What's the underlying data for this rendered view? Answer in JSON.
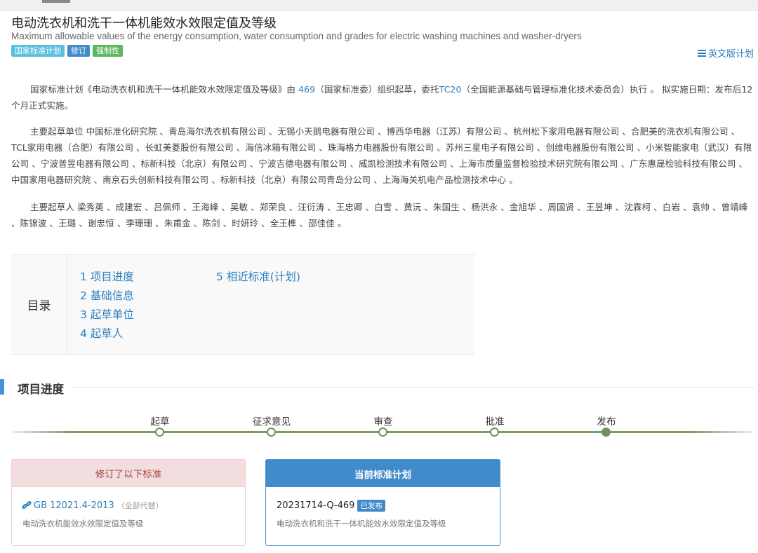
{
  "header": {
    "title": "电动洗衣机和洗干一体机能效水效限定值及等级",
    "subtitle": "Maximum allowable values of the energy consumption, water consumption and grades for electric washing machines and washer-dryers",
    "tags": [
      "国家标准计划",
      "修订",
      "强制性"
    ],
    "en_link": "英文版计划"
  },
  "intro": {
    "p1_a": "国家标准计划《电动洗衣机和洗干一体机能效水效限定值及等级》由 ",
    "p1_link1": "469",
    "p1_b": "（国家标准委）组织起草，委托",
    "p1_link2": "TC20",
    "p1_c": "（全国能源基础与管理标准化技术委员会）执行 。 拟实施日期：发布后12个月正式实施。",
    "p2": "主要起草单位 中国标准化研究院 、青岛海尔洗衣机有限公司 、无锡小天鹅电器有限公司 、博西华电器（江苏）有限公司 、杭州松下家用电器有限公司 、合肥美的洗衣机有限公司 、TCL家用电器（合肥）有限公司 、长虹美菱股份有限公司 、海信冰箱有限公司 、珠海格力电器股份有限公司 、苏州三星电子有限公司 、创维电器股份有限公司 、小米智能家电（武汉）有限公司 、宁波普昱电器有限公司 、标新科技（北京）有限公司 、宁波吉德电器有限公司 、威凯检测技术有限公司 、上海市质量监督检验技术研究院有限公司 、广东惠晟检验科技有限公司 、中国家用电器研究院 、南京石头创新科技有限公司 、标新科技（北京）有限公司青岛分公司 、上海海关机电产品检测技术中心 。",
    "p3": "主要起草人 梁秀英 、成建宏 、吕佩师 、王海峰 、吴敏 、郑荣良 、汪衍涛 、王忠卿 、白雪 、黄沅 、朱国生 、杨洪永 、金旭华 、周国贤 、王昱坤 、沈霖柯 、白岩 、袁帅 、曾靖峰 、陈锦波 、王璐 、谢忠恒 、李珊珊 、朱甫金 、陈剑 、时妍玲 、全王榫 、邵佳佳 。"
  },
  "toc": {
    "label": "目录",
    "items": [
      "1  项目进度",
      "2  基础信息",
      "3  起草单位",
      "4  起草人",
      "5  相近标准(计划)"
    ]
  },
  "progress": {
    "title": "项目进度",
    "steps": [
      "起草",
      "征求意见",
      "审查",
      "批准",
      "发布"
    ]
  },
  "cards": {
    "revised": {
      "header": "修订了以下标准",
      "code": "GB 12021.4-2013",
      "note": "（全部代替）",
      "name": "电动洗衣机能效水效限定值及等级"
    },
    "current": {
      "header": "当前标准计划",
      "code": "20231714-Q-469",
      "badge": "已发布",
      "name": "电动洗衣机和洗干一体机能效水效限定值及等级"
    }
  },
  "colors": {
    "accent": "#428bca",
    "link": "#2a7fbf",
    "timeline": "#6f9160",
    "revised_bg": "#f2dede"
  }
}
